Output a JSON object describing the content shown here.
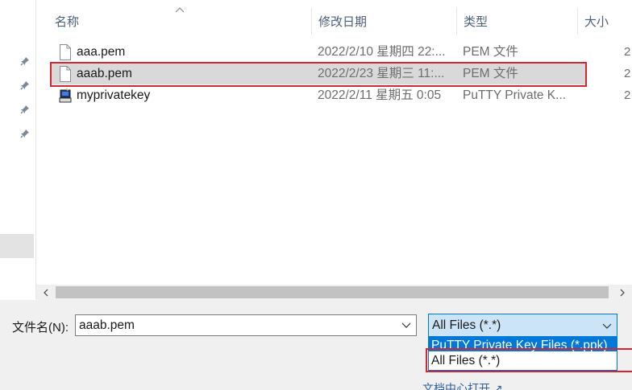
{
  "columns": {
    "name": "名称",
    "date": "修改日期",
    "type": "类型",
    "size": "大小"
  },
  "files": [
    {
      "name": "aaa.pem",
      "date": "2022/2/10 星期四 22:...",
      "type": "PEM 文件",
      "size": "2",
      "icon": "document-icon"
    },
    {
      "name": "aaab.pem",
      "date": "2022/2/23 星期三 11:...",
      "type": "PEM 文件",
      "size": "2",
      "icon": "document-icon",
      "selected": true
    },
    {
      "name": "myprivatekey",
      "date": "2022/2/11 星期五 0:05",
      "type": "PuTTY Private K...",
      "size": "2",
      "icon": "putty-key-icon"
    }
  ],
  "filename": {
    "label": "文件名(N):",
    "value": "aaab.pem"
  },
  "filetype": {
    "selected": "All Files (*.*)",
    "options": [
      "PuTTY Private Key Files (*.ppk)",
      "All Files (*.*)"
    ]
  },
  "link": "文档中心打开 ↗",
  "colors": {
    "accent": "#0078d7",
    "highlight": "#d22630",
    "selected_row": "#d9d9d9"
  }
}
